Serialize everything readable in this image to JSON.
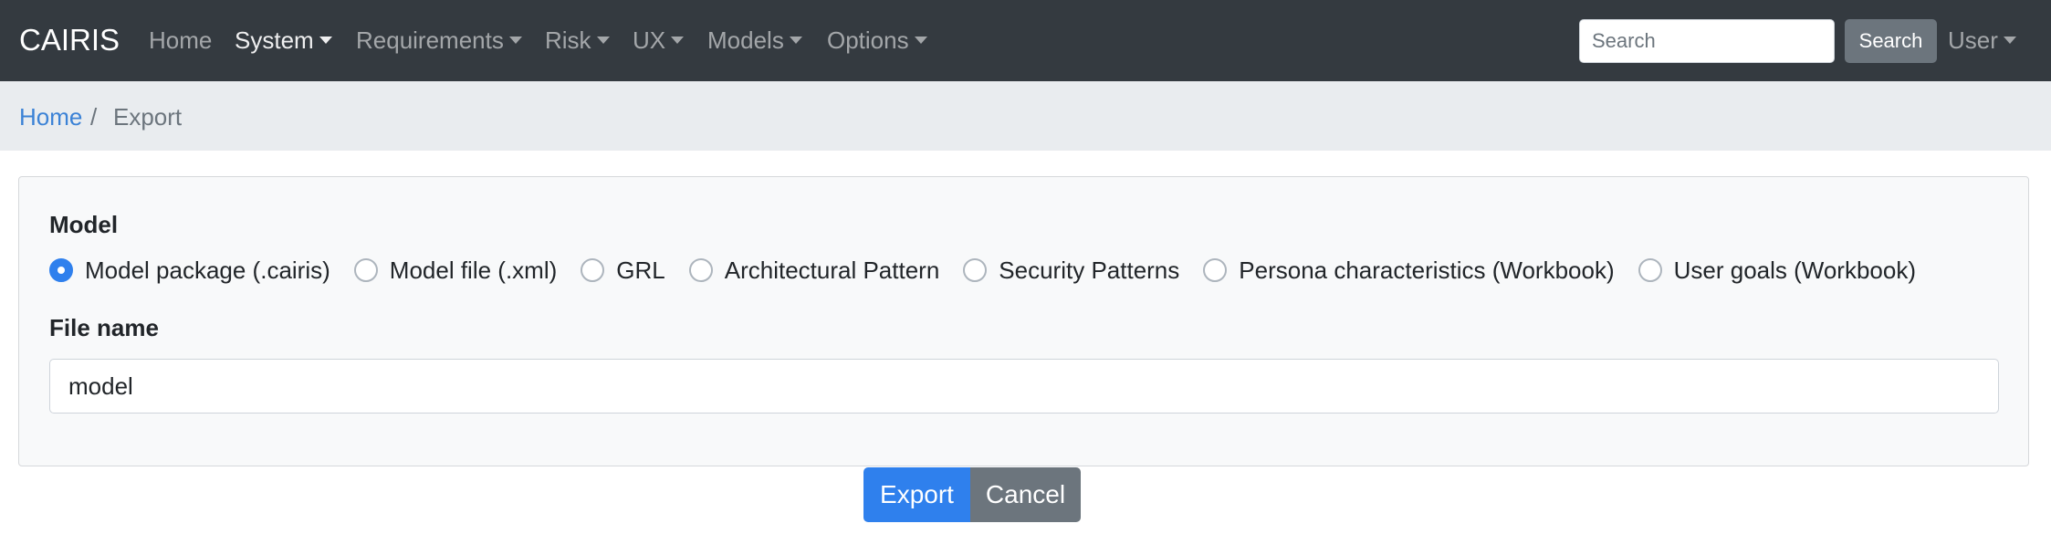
{
  "navbar": {
    "brand": "CAIRIS",
    "items": [
      {
        "label": "Home"
      },
      {
        "label": "System"
      },
      {
        "label": "Requirements"
      },
      {
        "label": "Risk"
      },
      {
        "label": "UX"
      },
      {
        "label": "Models"
      },
      {
        "label": "Options"
      }
    ],
    "search_placeholder": "Search",
    "search_button": "Search",
    "user_menu": "User"
  },
  "breadcrumb": {
    "home": "Home",
    "separator": "/",
    "current": "Export"
  },
  "form": {
    "model_label": "Model",
    "options": [
      {
        "label": "Model package (.cairis)",
        "checked": true
      },
      {
        "label": "Model file (.xml)",
        "checked": false
      },
      {
        "label": "GRL",
        "checked": false
      },
      {
        "label": "Architectural Pattern",
        "checked": false
      },
      {
        "label": "Security Patterns",
        "checked": false
      },
      {
        "label": "Persona characteristics (Workbook)",
        "checked": false
      },
      {
        "label": "User goals (Workbook)",
        "checked": false
      }
    ],
    "file_name_label": "File name",
    "file_name_value": "model"
  },
  "actions": {
    "export_label": "Export",
    "cancel_label": "Cancel"
  },
  "colors": {
    "navbar_bg": "#343a40",
    "breadcrumb_bg": "#e9ecef",
    "primary": "#2f80ed",
    "secondary": "#6c757d",
    "link": "#3b82d6"
  }
}
